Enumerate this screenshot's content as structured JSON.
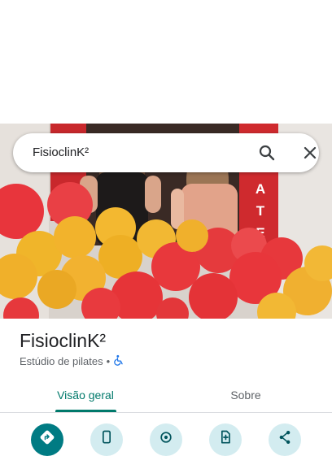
{
  "search": {
    "query": "FisioclinK²"
  },
  "hero": {
    "banner_letters": [
      "A",
      "T",
      "E"
    ]
  },
  "place": {
    "name": "FisioclinK²",
    "category": "Estúdio de pilates",
    "separator": "•"
  },
  "tabs": [
    {
      "label": "Visão geral",
      "selected": true
    },
    {
      "label": "Sobre",
      "selected": false
    }
  ],
  "actions": [
    {
      "icon": "directions-icon"
    },
    {
      "icon": "phone-icon"
    },
    {
      "icon": "save-location-icon"
    },
    {
      "icon": "add-document-icon"
    },
    {
      "icon": "share-icon"
    }
  ],
  "colors": {
    "accent": "#00796b",
    "directions_bg": "#007b83",
    "action_bg": "#d3ecf0",
    "wheelchair_icon": "#1a73e8"
  }
}
